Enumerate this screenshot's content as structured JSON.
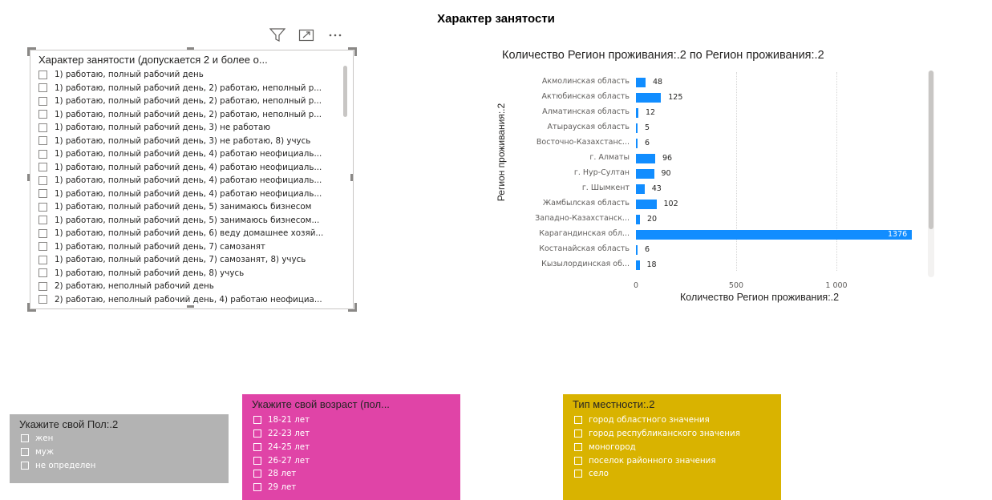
{
  "page_title": "Характер занятости",
  "main_slicer": {
    "title": "Характер занятости (допускается 2 и более о...",
    "items": [
      "1) работаю, полный рабочий день",
      "1) работаю, полный рабочий день, 2) работаю, неполный р...",
      "1) работаю, полный рабочий день, 2) работаю, неполный р...",
      "1) работаю, полный рабочий день, 2) работаю, неполный р...",
      "1) работаю, полный рабочий день, 3) не работаю",
      "1) работаю, полный рабочий день, 3) не работаю, 8) учусь",
      "1) работаю, полный рабочий день, 4) работаю неофициаль...",
      "1) работаю, полный рабочий день, 4) работаю неофициаль...",
      "1) работаю, полный рабочий день, 4) работаю неофициаль...",
      "1) работаю, полный рабочий день, 4) работаю неофициаль...",
      "1) работаю, полный рабочий день, 5) занимаюсь бизнесом",
      "1) работаю, полный рабочий день, 5) занимаюсь бизнесом...",
      "1) работаю, полный рабочий день, 6) веду домашнее хозяй...",
      "1) работаю, полный рабочий день, 7) самозанят",
      "1) работаю, полный рабочий день, 7) самозанят, 8) учусь",
      "1) работаю, полный рабочий день, 8) учусь",
      "2) работаю, неполный рабочий день",
      "2) работаю, неполный рабочий день, 4) работаю неофициа..."
    ],
    "header_icons": [
      "filter-icon",
      "focus-mode-icon",
      "more-options-icon"
    ]
  },
  "chart_data": {
    "type": "bar",
    "orientation": "horizontal",
    "title": "Количество Регион проживания:.2 по Регион проживания:.2",
    "xlabel": "Количество Регион проживания:.2",
    "ylabel": "Регион проживания:.2",
    "categories": [
      "Акмолинская область",
      "Актюбинская область",
      "Алматинская область",
      "Атырауская область",
      "Восточно-Казахстанс...",
      "г. Алматы",
      "г. Нур-Султан",
      "г. Шымкент",
      "Жамбылская область",
      "Западно-Казахстанск...",
      "Карагандинская обл...",
      "Костанайская область",
      "Кызылординская об..."
    ],
    "values": [
      48,
      125,
      12,
      5,
      6,
      96,
      90,
      43,
      102,
      20,
      1376,
      6,
      18
    ],
    "xticks": [
      "0",
      "500",
      "1 000"
    ],
    "xtick_values": [
      0,
      500,
      1000
    ],
    "xlim": [
      0,
      1376
    ],
    "bar_color": "#118dff",
    "grid": true
  },
  "gender_slicer": {
    "title": "Укажите свой Пол:.2",
    "items": [
      "жен",
      "муж",
      "не определен"
    ],
    "bg_color": "#b3b3b3",
    "text_color": "#ffffff"
  },
  "age_slicer": {
    "title": "Укажите свой возраст (пол...",
    "items": [
      "18-21 лет",
      "22-23 лет",
      "24-25 лет",
      "26-27 лет",
      "28 лет",
      "29 лет"
    ],
    "bg_color": "#e044a7",
    "text_color": "#ffffff"
  },
  "locality_slicer": {
    "title": "Тип местности:.2",
    "items": [
      "город областного значения",
      "город республиканского значения",
      "моногород",
      "поселок районного значения",
      "село"
    ],
    "bg_color": "#d9b300",
    "text_color": "#ffffff"
  }
}
